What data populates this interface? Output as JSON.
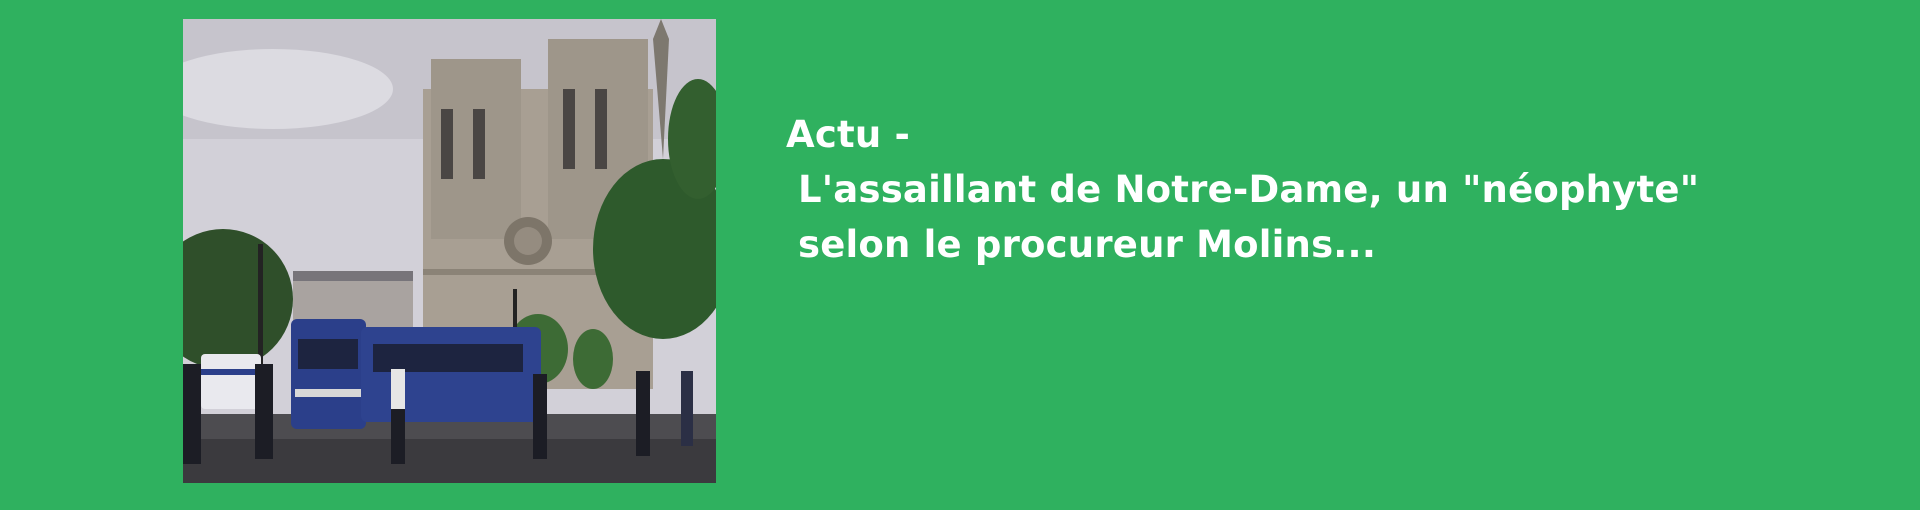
{
  "article": {
    "category": "Actu -",
    "headline_line1": "L'assaillant de Notre-Dame, un \"néophyte\"",
    "headline_line2": "selon le procureur Molins...",
    "image_subject": "Notre-Dame cathedral with police vans"
  },
  "colors": {
    "background": "#2fb15f",
    "text": "#ffffff"
  }
}
